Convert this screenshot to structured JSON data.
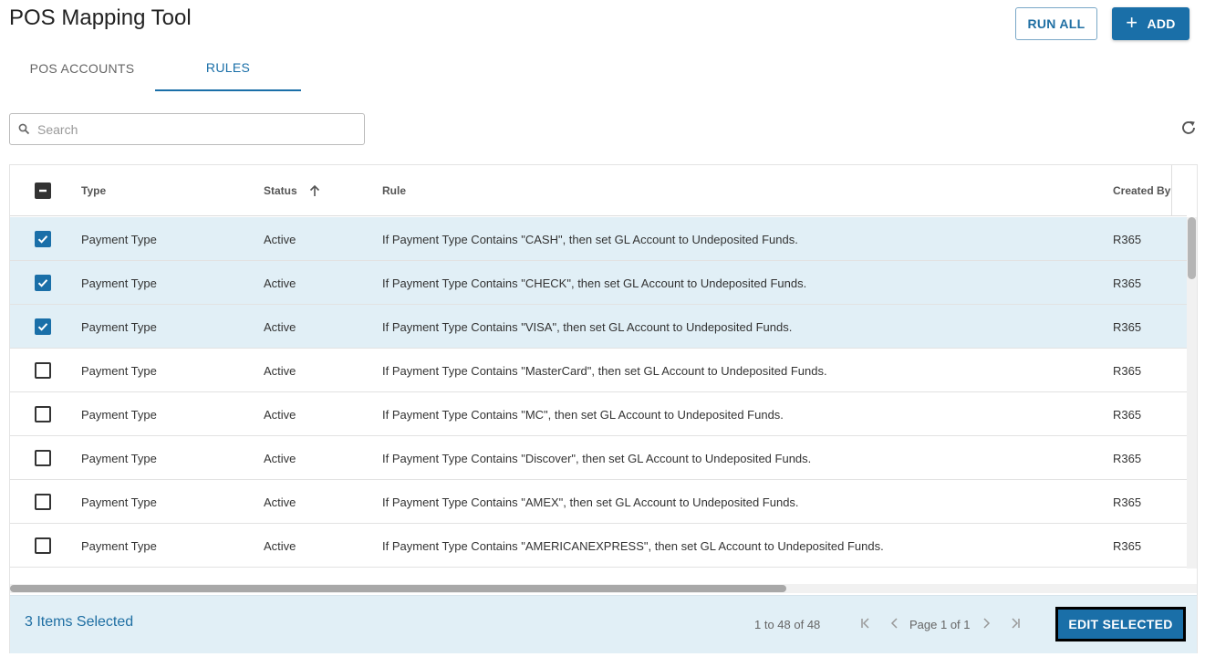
{
  "app": {
    "title": "POS Mapping Tool"
  },
  "toolbar": {
    "run_all_label": "RUN ALL",
    "add_label": "ADD",
    "add_icon": "plus-icon"
  },
  "tabs": [
    {
      "label": "POS ACCOUNTS",
      "active": false
    },
    {
      "label": "RULES",
      "active": true
    }
  ],
  "search": {
    "placeholder": "Search",
    "value": ""
  },
  "table": {
    "columns": [
      {
        "label": "Type"
      },
      {
        "label": "Status",
        "sort": "ascending"
      },
      {
        "label": "Rule"
      },
      {
        "label": "Created By"
      }
    ],
    "header_checkbox": "indeterminate",
    "rows": [
      {
        "checked": true,
        "type": "Payment Type",
        "status": "Active",
        "rule": "If Payment Type Contains \"CASH\", then set GL Account to Undeposited Funds.",
        "created_by": "R365"
      },
      {
        "checked": true,
        "type": "Payment Type",
        "status": "Active",
        "rule": "If Payment Type Contains \"CHECK\", then set GL Account to Undeposited Funds.",
        "created_by": "R365"
      },
      {
        "checked": true,
        "type": "Payment Type",
        "status": "Active",
        "rule": "If Payment Type Contains \"VISA\", then set GL Account to Undeposited Funds.",
        "created_by": "R365"
      },
      {
        "checked": false,
        "type": "Payment Type",
        "status": "Active",
        "rule": "If Payment Type Contains \"MasterCard\", then set GL Account to Undeposited Funds.",
        "created_by": "R365"
      },
      {
        "checked": false,
        "type": "Payment Type",
        "status": "Active",
        "rule": "If Payment Type Contains \"MC\", then set GL Account to Undeposited Funds.",
        "created_by": "R365"
      },
      {
        "checked": false,
        "type": "Payment Type",
        "status": "Active",
        "rule": "If Payment Type Contains \"Discover\", then set GL Account to Undeposited Funds.",
        "created_by": "R365"
      },
      {
        "checked": false,
        "type": "Payment Type",
        "status": "Active",
        "rule": "If Payment Type Contains \"AMEX\", then set GL Account to Undeposited Funds.",
        "created_by": "R365"
      },
      {
        "checked": false,
        "type": "Payment Type",
        "status": "Active",
        "rule": "If Payment Type Contains \"AMERICANEXPRESS\", then set GL Account to Undeposited Funds.",
        "created_by": "R365"
      }
    ]
  },
  "footer": {
    "selected_text": "3 Items Selected",
    "range_text": "1 to 48 of 48",
    "page_text": "Page 1 of 1",
    "edit_label": "EDIT SELECTED"
  },
  "colors": {
    "accent": "#1a6fa8",
    "selected_row": "#e1eff6"
  }
}
